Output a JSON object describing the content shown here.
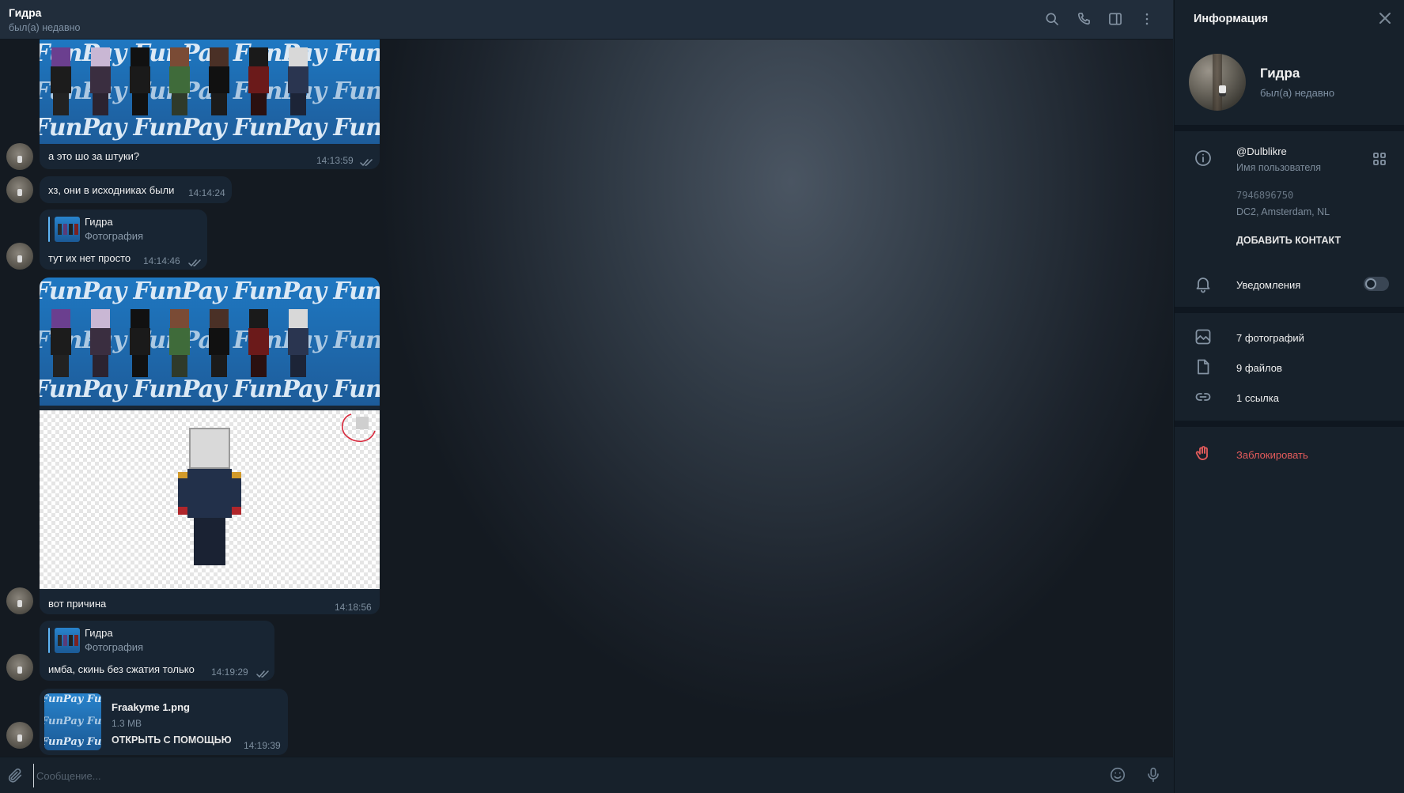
{
  "chat": {
    "title": "Гидра",
    "status": "был(а) недавно"
  },
  "messages": [
    {
      "type": "photo_caption",
      "text": "а это шо за штуки?",
      "time": "14:13:59"
    },
    {
      "type": "text",
      "text": "хз, они в исходниках были",
      "time": "14:14:24"
    },
    {
      "type": "reply",
      "reply_name": "Гидра",
      "reply_sub": "Фотография",
      "text": "тут их нет просто",
      "time": "14:14:46"
    },
    {
      "type": "album",
      "text": "вот причина",
      "time": "14:18:56"
    },
    {
      "type": "reply",
      "reply_name": "Гидра",
      "reply_sub": "Фотография",
      "text": "имба, скинь без сжатия только",
      "time": "14:19:29"
    },
    {
      "type": "file",
      "file_name": "Fraakyme 1.png",
      "file_size": "1.3 MB",
      "open_label": "ОТКРЫТЬ С ПОМОЩЬЮ",
      "time": "14:19:39"
    }
  ],
  "funpay_text": "FunPay FunPay FunPay FunPay FunPay",
  "composer": {
    "placeholder": "Сообщение..."
  },
  "icons": {
    "header": [
      "search-icon",
      "phone-icon",
      "sidebar-toggle-icon",
      "more-vertical-icon"
    ],
    "composer": [
      "paperclip-icon",
      "emoji-icon",
      "microphone-icon"
    ]
  },
  "info": {
    "title": "Информация",
    "name": "Гидра",
    "status": "был(а) недавно",
    "username": "@Dulblikre",
    "username_label": "Имя пользователя",
    "phone": "7946896750",
    "dc": "DC2, Amsterdam, NL",
    "add_contact": "ДОБАВИТЬ КОНТАКТ",
    "notifications": "Уведомления",
    "notifications_on": false,
    "photos": "7 фотографий",
    "files": "9 файлов",
    "links": "1 ссылка",
    "block": "Заблокировать"
  },
  "colors": {
    "bubble": "#182533",
    "header": "#212d3b",
    "panel": "#17212b",
    "accent": "#5eb5f7",
    "danger": "#e35b5b"
  }
}
